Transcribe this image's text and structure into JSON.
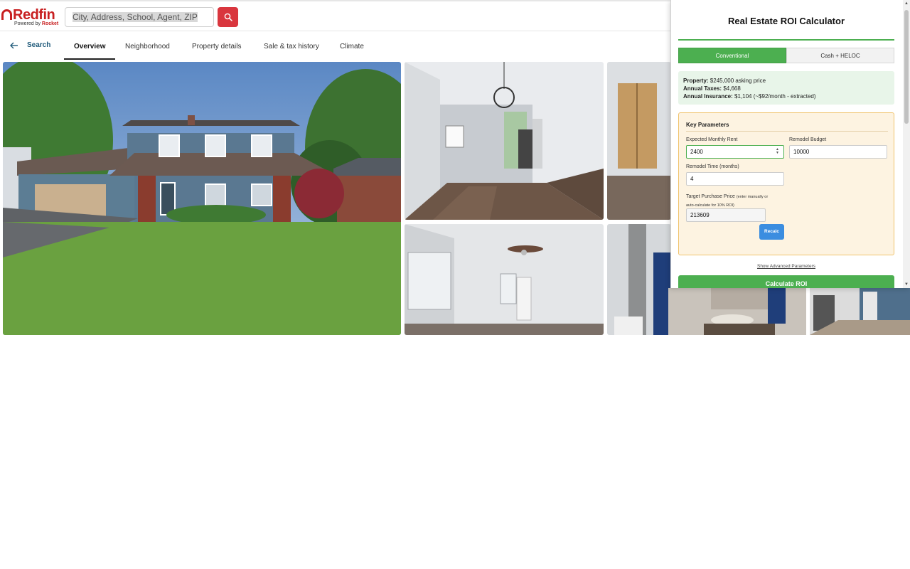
{
  "header": {
    "logo_name": "Redfin",
    "logo_powered": "Powered by",
    "logo_partner": "Rocket",
    "search_placeholder": "City, Address, School, Agent, ZIP",
    "search_icon": "search-icon"
  },
  "nav": {
    "back_label": "Search",
    "tabs": [
      "Overview",
      "Neighborhood",
      "Property details",
      "Sale & tax history",
      "Climate"
    ],
    "active_tab": "Overview"
  },
  "roi": {
    "title": "Real Estate ROI Calculator",
    "tab_conventional": "Conventional",
    "tab_cash": "Cash + HELOC",
    "active_tab": "Conventional",
    "property_label": "Property:",
    "property_value": "$245,000 asking price",
    "taxes_label": "Annual Taxes:",
    "taxes_value": "$4,668",
    "insurance_label": "Annual Insurance:",
    "insurance_value": "$1,104 (~$92/month - extracted)",
    "key_params_title": "Key Parameters",
    "rent_label": "Expected Monthly Rent",
    "rent_value": "2400",
    "remodel_budget_label": "Remodel Budget",
    "remodel_budget_value": "10000",
    "remodel_time_label": "Remodel Time (months)",
    "remodel_time_value": "4",
    "target_price_label": "Target Purchase Price",
    "target_price_hint_1": "(enter manually or",
    "target_price_hint_2": "auto-calculate for 10% ROI)",
    "target_price_value": "213609",
    "recalc_label": "Recalc",
    "advanced_link": "Show Advanced Parameters",
    "calculate_label": "Calculate ROI"
  },
  "colors": {
    "brand_red": "#c82021",
    "accent_green": "#4caf50",
    "recalc_blue": "#3b8de0",
    "params_bg": "#fdf3e1",
    "info_bg": "#e8f5e9"
  }
}
